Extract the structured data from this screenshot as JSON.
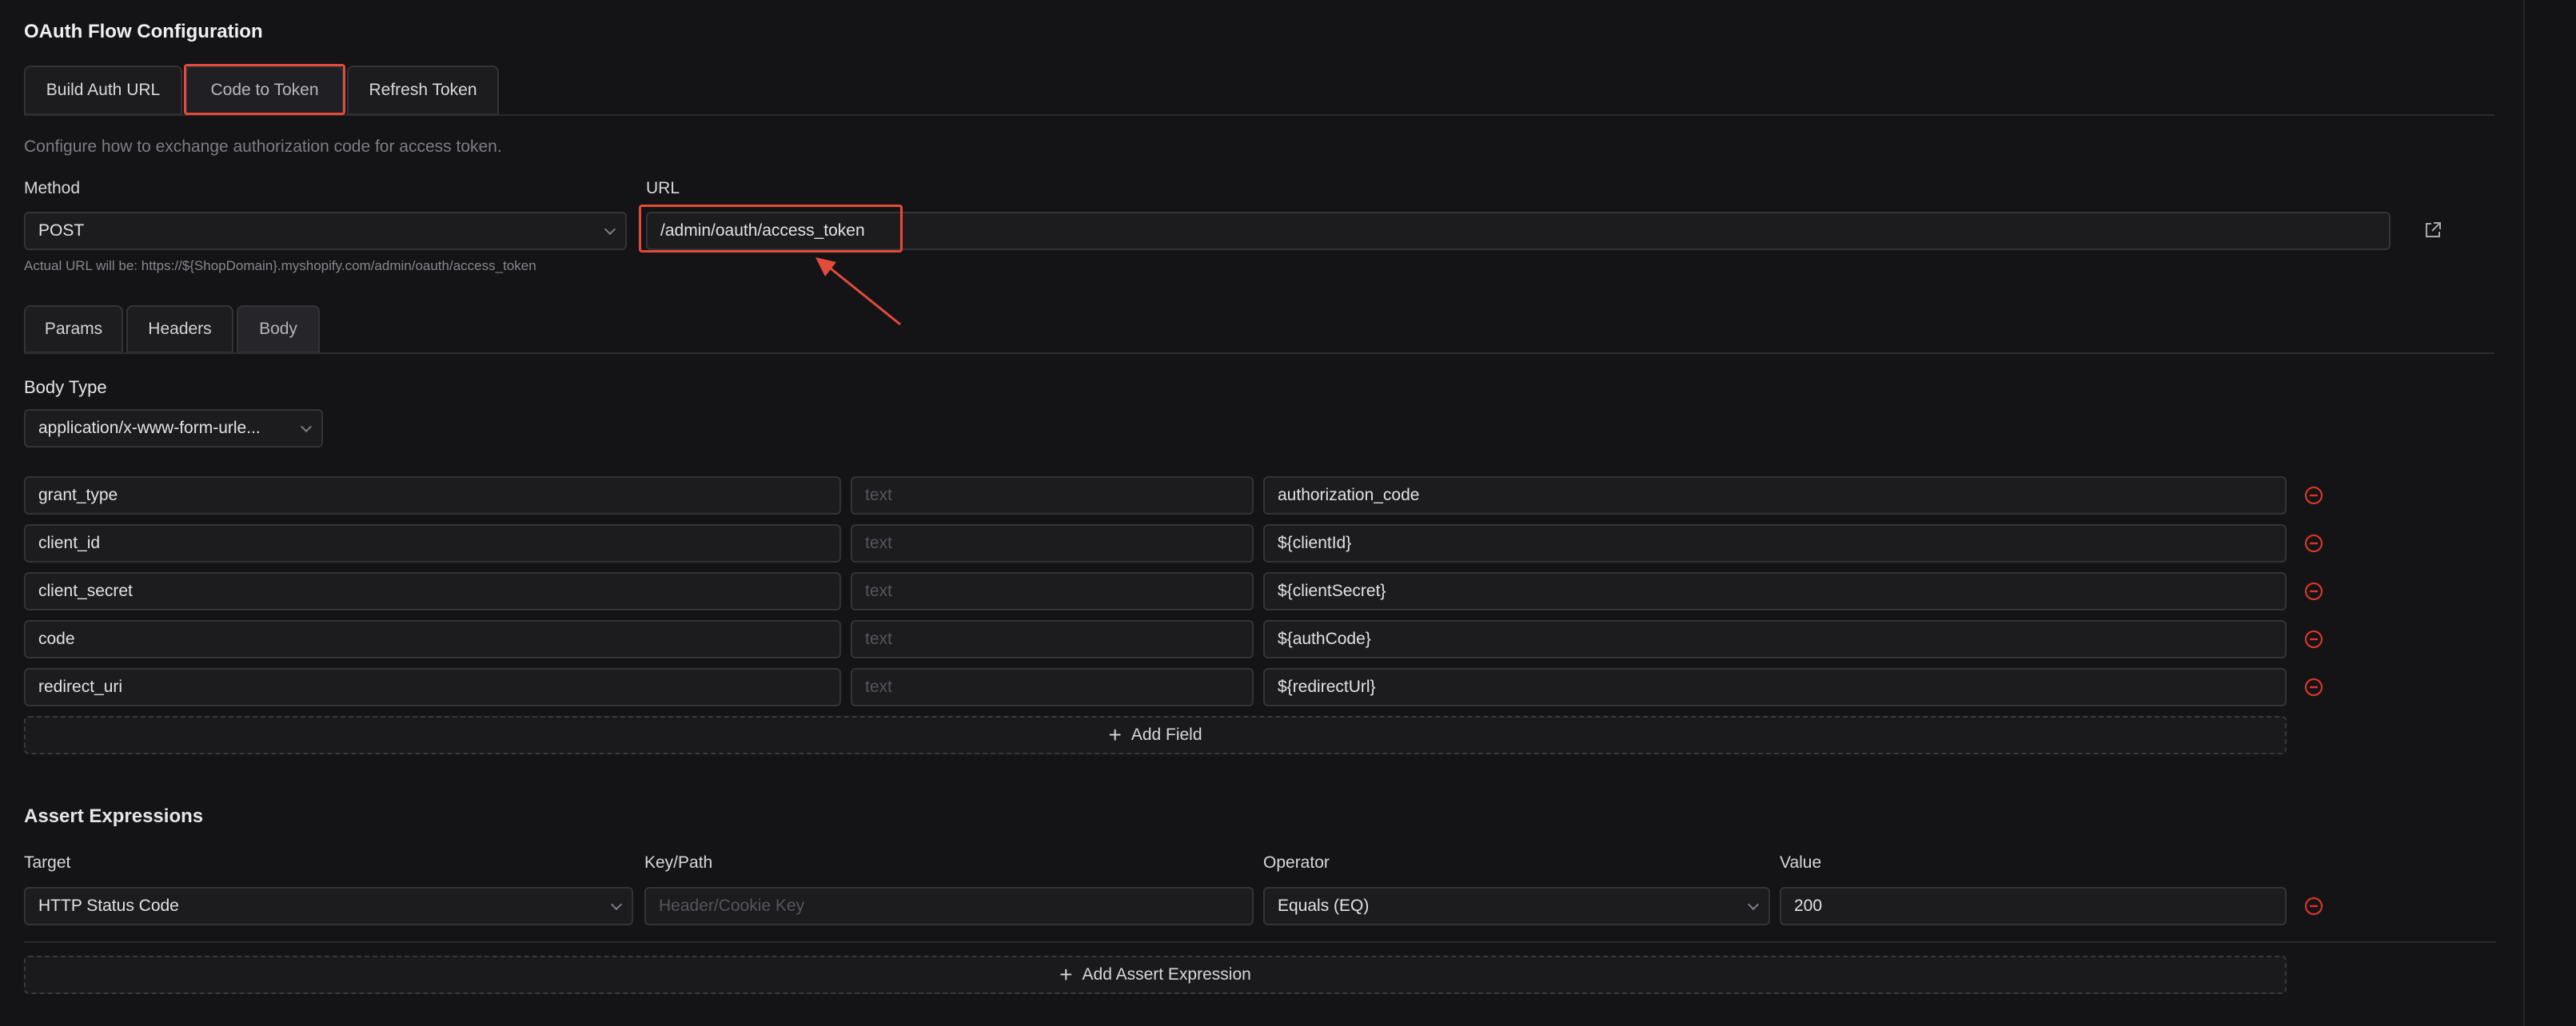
{
  "page": {
    "title": "OAuth Flow Configuration",
    "accent_highlight": "#e34b3a",
    "danger_color": "#d9342b"
  },
  "tabs": [
    {
      "label": "Build Auth URL"
    },
    {
      "label": "Code to Token",
      "active": true
    },
    {
      "label": "Refresh Token"
    }
  ],
  "description": "Configure how to exchange authorization code for access token.",
  "request": {
    "method_label": "Method",
    "method_value": "POST",
    "url_label": "URL",
    "url_value": "/admin/oauth/access_token",
    "actual_url_hint": "Actual URL will be: https://${ShopDomain}.myshopify.com/admin/oauth/access_token",
    "open_icon": "external-link-icon"
  },
  "subtabs": [
    {
      "label": "Params"
    },
    {
      "label": "Headers"
    },
    {
      "label": "Body",
      "active": true
    }
  ],
  "body": {
    "type_label": "Body Type",
    "type_value": "application/x-www-form-urle...",
    "type_placeholder_middle": "text",
    "fields": [
      {
        "key": "grant_type",
        "type": "text",
        "value": "authorization_code"
      },
      {
        "key": "client_id",
        "type": "text",
        "value": "${clientId}"
      },
      {
        "key": "client_secret",
        "type": "text",
        "value": "${clientSecret}"
      },
      {
        "key": "code",
        "type": "text",
        "value": "${authCode}"
      },
      {
        "key": "redirect_uri",
        "type": "text",
        "value": "${redirectUrl}"
      }
    ],
    "add_field_label": "Add Field"
  },
  "asserts": {
    "title": "Assert Expressions",
    "target_label": "Target",
    "key_label": "Key/Path",
    "operator_label": "Operator",
    "value_label": "Value",
    "rows": [
      {
        "target": "HTTP Status Code",
        "key_placeholder": "Header/Cookie Key",
        "operator": "Equals (EQ)",
        "value": "200"
      }
    ],
    "add_label": "Add Assert Expression"
  }
}
